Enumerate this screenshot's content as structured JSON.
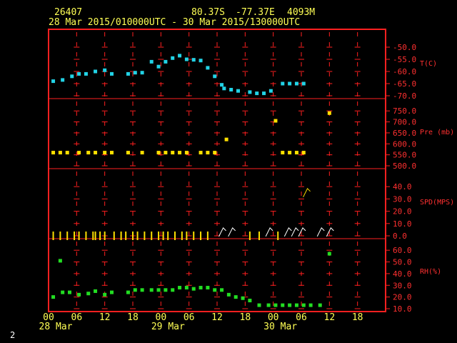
{
  "header": {
    "station": "26407",
    "lat": "80.37S",
    "lon": "-77.37E",
    "elev": "4093M",
    "range": "28 Mar 2015/010000UTC - 30 Mar 2015/130000UTC"
  },
  "footer": {
    "page_number": "2"
  },
  "colors": {
    "frame": "#ff2020",
    "temp": "#22d3e6",
    "pres": "#ffe000",
    "wind": "#ffe000",
    "wind_light": "#ffffff",
    "rh": "#22dd22",
    "text_yellow": "#ffff55"
  },
  "chart_data": {
    "type": "scatter",
    "x_hours_ticks": [
      "00",
      "06",
      "12",
      "18",
      "00",
      "06",
      "12",
      "18",
      "00",
      "06",
      "12",
      "18"
    ],
    "date_labels": [
      {
        "label": "28 Mar",
        "hour": 0
      },
      {
        "label": "29 Mar",
        "hour": 24
      },
      {
        "label": "30 Mar",
        "hour": 48
      }
    ],
    "x_range_hours": [
      0,
      66
    ],
    "panels": [
      {
        "name": "T(C)",
        "ylim": [
          -70,
          -45
        ],
        "ticks": [
          -50,
          -55,
          -60,
          -65,
          -70
        ],
        "tick_labels": [
          "-50.0",
          "-55.0",
          "-60.0",
          "-65.0",
          "-70.0"
        ],
        "series": [
          {
            "values": [
              [
                1,
                -64
              ],
              [
                3,
                -63.5
              ],
              [
                5,
                -62
              ],
              [
                6.5,
                -61
              ],
              [
                8,
                -61
              ],
              [
                10,
                -60
              ],
              [
                12,
                -59.5
              ],
              [
                13.5,
                -61
              ],
              [
                17,
                -61
              ],
              [
                18.5,
                -60.5
              ],
              [
                20,
                -60.5
              ],
              [
                22,
                -56
              ],
              [
                23.5,
                -58
              ],
              [
                25,
                -56
              ],
              [
                26.5,
                -54.5
              ],
              [
                28,
                -53.5
              ],
              [
                29.5,
                -55
              ],
              [
                31,
                -55.2
              ],
              [
                32.5,
                -55.5
              ],
              [
                34,
                -58.5
              ],
              [
                35.5,
                -62
              ],
              [
                37,
                -65.5
              ],
              [
                37.5,
                -67
              ],
              [
                39,
                -67.5
              ],
              [
                40.5,
                -68
              ],
              [
                43,
                -68.5
              ],
              [
                44.5,
                -69
              ],
              [
                46,
                -69
              ],
              [
                47.5,
                -68
              ],
              [
                50,
                -65
              ],
              [
                51.5,
                -65
              ],
              [
                53,
                -65
              ],
              [
                54.5,
                -65
              ]
            ]
          }
        ]
      },
      {
        "name": "Pre (mb)",
        "ylim": [
          500,
          780
        ],
        "ticks": [
          750,
          700,
          650,
          600,
          550,
          500
        ],
        "tick_labels": [
          "750.0",
          "700.0",
          "650.0",
          "600.0",
          "550.0",
          "500.0"
        ],
        "series": [
          {
            "values": [
              [
                1,
                560
              ],
              [
                2.5,
                560
              ],
              [
                4,
                560
              ],
              [
                6.5,
                560
              ],
              [
                8.5,
                560
              ],
              [
                10,
                560
              ],
              [
                12,
                560
              ],
              [
                13.5,
                560
              ],
              [
                17,
                560
              ],
              [
                20,
                560
              ],
              [
                23.5,
                560
              ],
              [
                25,
                560
              ],
              [
                26.5,
                560
              ],
              [
                28,
                560
              ],
              [
                29.5,
                560
              ],
              [
                32.5,
                560
              ],
              [
                34,
                560
              ],
              [
                35.5,
                560
              ],
              [
                38,
                620
              ],
              [
                50,
                560
              ],
              [
                51.5,
                560
              ],
              [
                53,
                560
              ],
              [
                54.5,
                560
              ],
              [
                48.5,
                705
              ],
              [
                60,
                740
              ]
            ]
          }
        ]
      },
      {
        "name": "SPD(MPS)",
        "ylim": [
          0,
          50
        ],
        "ticks": [
          40,
          30,
          20,
          10,
          0
        ],
        "tick_labels": [
          "40.0",
          "30.0",
          "20.0",
          "10.0",
          "0.0"
        ],
        "series": [
          {
            "values": [
              [
                1,
                0
              ],
              [
                2.5,
                0
              ],
              [
                4,
                0
              ],
              [
                5.5,
                0
              ],
              [
                6.5,
                0
              ],
              [
                8,
                0
              ],
              [
                9.5,
                0
              ],
              [
                10,
                0
              ],
              [
                11,
                0
              ],
              [
                12,
                0
              ],
              [
                14,
                0
              ],
              [
                15.5,
                0
              ],
              [
                16.5,
                0
              ],
              [
                18,
                0
              ],
              [
                19,
                0
              ],
              [
                20.5,
                0
              ],
              [
                22,
                0
              ],
              [
                23.5,
                0
              ],
              [
                24.5,
                0
              ],
              [
                25.5,
                0
              ],
              [
                27,
                0
              ],
              [
                28.5,
                0
              ],
              [
                29.5,
                0
              ],
              [
                31,
                0
              ],
              [
                32.5,
                0
              ],
              [
                34,
                0
              ],
              [
                37,
                3
              ],
              [
                39,
                3
              ],
              [
                43,
                0
              ],
              [
                45,
                0
              ],
              [
                47,
                3
              ],
              [
                49,
                0
              ],
              [
                51,
                3
              ],
              [
                52.5,
                3
              ],
              [
                54,
                3
              ],
              [
                55,
                35
              ],
              [
                58,
                3
              ],
              [
                60,
                3
              ]
            ]
          }
        ]
      },
      {
        "name": "RH(%)",
        "ylim": [
          10,
          65
        ],
        "ticks": [
          60,
          50,
          40,
          30,
          20,
          10
        ],
        "tick_labels": [
          "60.0",
          "50.0",
          "40.0",
          "30.0",
          "20.0",
          "10.0"
        ],
        "series": [
          {
            "values": [
              [
                1,
                20
              ],
              [
                2.5,
                51
              ],
              [
                3,
                24
              ],
              [
                4.5,
                24
              ],
              [
                6.5,
                22
              ],
              [
                8.5,
                23
              ],
              [
                10,
                25
              ],
              [
                12,
                22
              ],
              [
                13.5,
                24
              ],
              [
                17,
                24
              ],
              [
                18.5,
                26
              ],
              [
                20,
                26
              ],
              [
                22,
                26
              ],
              [
                23.5,
                26
              ],
              [
                25,
                26
              ],
              [
                26.5,
                26
              ],
              [
                28,
                28
              ],
              [
                29.5,
                28
              ],
              [
                31,
                27
              ],
              [
                32.5,
                28
              ],
              [
                34,
                28
              ],
              [
                35.5,
                26
              ],
              [
                37,
                26
              ],
              [
                38.5,
                22
              ],
              [
                40,
                20
              ],
              [
                41.5,
                19
              ],
              [
                43,
                17
              ],
              [
                45,
                13
              ],
              [
                47,
                13
              ],
              [
                48.5,
                13
              ],
              [
                50,
                13
              ],
              [
                51.5,
                13
              ],
              [
                53,
                13
              ],
              [
                54.5,
                13
              ],
              [
                56,
                13
              ],
              [
                58,
                13
              ],
              [
                60,
                57
              ]
            ]
          }
        ]
      }
    ]
  }
}
